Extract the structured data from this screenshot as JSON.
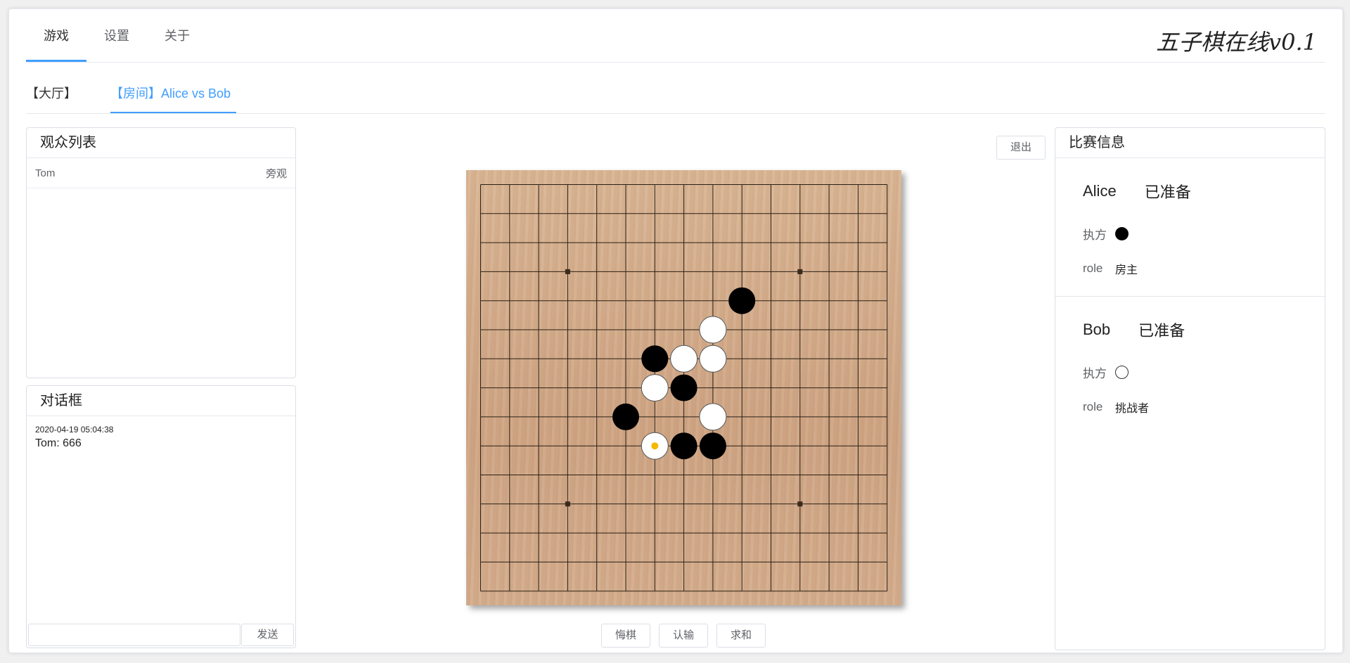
{
  "brand": "五子棋在线v0.1",
  "top_tabs": [
    {
      "label": "游戏",
      "active": true
    },
    {
      "label": "设置",
      "active": false
    },
    {
      "label": "关于",
      "active": false
    }
  ],
  "sub_tabs": [
    {
      "label": "【大厅】",
      "active": false
    },
    {
      "label": "【房间】Alice vs Bob",
      "active": true
    }
  ],
  "audience": {
    "title": "观众列表",
    "rows": [
      {
        "name": "Tom",
        "status": "旁观"
      }
    ]
  },
  "chat": {
    "title": "对话框",
    "messages": [
      {
        "time": "2020-04-19 05:04:38",
        "text": "Tom: 666"
      }
    ],
    "input_value": "",
    "send_label": "发送"
  },
  "game": {
    "exit_label": "退出",
    "buttons": {
      "undo": "悔棋",
      "resign": "认输",
      "draw": "求和"
    },
    "board": {
      "size": 15,
      "star_points": [
        [
          3,
          3
        ],
        [
          3,
          11
        ],
        [
          11,
          3
        ],
        [
          11,
          11
        ]
      ],
      "stones": [
        {
          "col": 9,
          "row": 4,
          "color": "black"
        },
        {
          "col": 8,
          "row": 5,
          "color": "white"
        },
        {
          "col": 6,
          "row": 6,
          "color": "black"
        },
        {
          "col": 7,
          "row": 6,
          "color": "white"
        },
        {
          "col": 8,
          "row": 6,
          "color": "white"
        },
        {
          "col": 6,
          "row": 7,
          "color": "white"
        },
        {
          "col": 7,
          "row": 7,
          "color": "black"
        },
        {
          "col": 5,
          "row": 8,
          "color": "black"
        },
        {
          "col": 8,
          "row": 8,
          "color": "white"
        },
        {
          "col": 6,
          "row": 9,
          "color": "white",
          "last": true
        },
        {
          "col": 7,
          "row": 9,
          "color": "black"
        },
        {
          "col": 8,
          "row": 9,
          "color": "black"
        }
      ],
      "last_move_color": "#f5b800"
    }
  },
  "match_info": {
    "title": "比赛信息",
    "players": [
      {
        "name": "Alice",
        "status": "已准备",
        "side_label": "执方",
        "side": "black",
        "role_label": "role",
        "role": "房主"
      },
      {
        "name": "Bob",
        "status": "已准备",
        "side_label": "执方",
        "side": "white",
        "role_label": "role",
        "role": "挑战者"
      }
    ]
  }
}
